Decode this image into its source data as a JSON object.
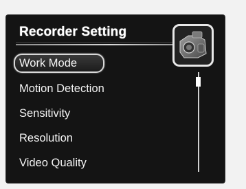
{
  "menu": {
    "title": "Recorder Setting",
    "items": [
      {
        "label": "Work Mode",
        "selected": true
      },
      {
        "label": "Motion Detection",
        "selected": false
      },
      {
        "label": "Sensitivity",
        "selected": false
      },
      {
        "label": "Resolution",
        "selected": false
      },
      {
        "label": "Video Quality",
        "selected": false
      }
    ]
  },
  "scroll": {
    "position": 0.0
  },
  "icons": {
    "header_icon": "camera-icon"
  },
  "colors": {
    "background": "#141414",
    "text": "#f4f4f4",
    "highlight_border": "#d9d9d9"
  }
}
